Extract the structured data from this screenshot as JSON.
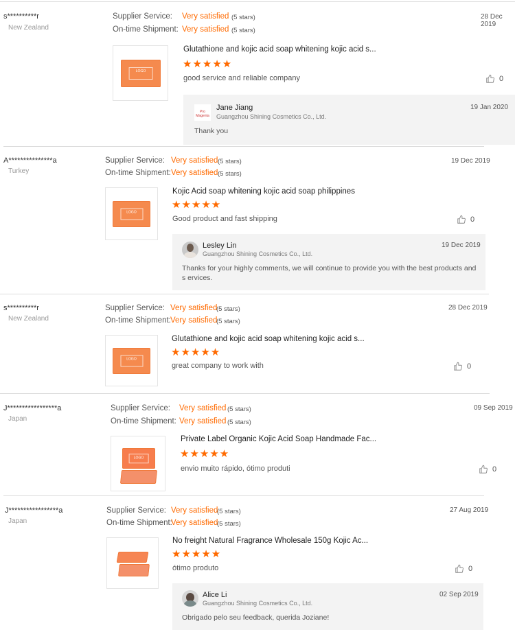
{
  "labels": {
    "supplier_service": "Supplier Service:",
    "ontime_shipment": "On-time Shipment:"
  },
  "reviews": [
    {
      "buyer": "s**********r",
      "country": "New Zealand",
      "service": "Very satisfied",
      "service_stars": "(5 stars)",
      "shipment": "Very satisfied",
      "shipment_stars": "(5 stars)",
      "date": "28 Dec 2019",
      "product": "Glutathione and kojic acid soap whitening kojic acid s...",
      "rating": "★★★★★",
      "comment": "good service and reliable company",
      "likes": "0",
      "reply": {
        "name": "Jane Jiang",
        "company": "Guangzhou Shining Cosmetics Co., Ltd.",
        "date": "19 Jan 2020",
        "text": "Thank you"
      }
    },
    {
      "buyer": "A***************a",
      "country": "Turkey",
      "service": "Very satisfied",
      "service_stars": "(5 stars)",
      "shipment": "Very satisfied",
      "shipment_stars": "(5 stars)",
      "date": "19 Dec 2019",
      "product": "Kojic Acid soap whitening kojic acid soap philippines",
      "rating": "★★★★★",
      "comment": "Good product and fast shipping",
      "likes": "0",
      "reply": {
        "name": "Lesley Lin",
        "company": "Guangzhou Shining Cosmetics Co., Ltd.",
        "date": "19 Dec 2019",
        "text": "Thanks for your highly comments, we will continue to provide you with the best products and s ervices."
      }
    },
    {
      "buyer": "s**********r",
      "country": "New Zealand",
      "service": "Very satisfied",
      "service_stars": "(5 stars)",
      "shipment": "Very satisfied",
      "shipment_stars": "(5 stars)",
      "date": "28 Dec 2019",
      "product": "Glutathione and kojic acid soap whitening kojic acid s...",
      "rating": "★★★★★",
      "comment": "great company to work with",
      "likes": "0"
    },
    {
      "buyer": "J*****************a",
      "country": "Japan",
      "service": "Very satisfied",
      "service_stars": "(5 stars)",
      "shipment": "Very satisfied",
      "shipment_stars": "(5 stars)",
      "date": "09 Sep 2019",
      "product": "Private Label Organic Kojic Acid Soap Handmade Fac...",
      "rating": "★★★★★",
      "comment": "envio muito rápido, ótimo produti",
      "likes": "0"
    },
    {
      "buyer": "J*****************a",
      "country": "Japan",
      "service": "Very satisfied",
      "service_stars": "(5 stars)",
      "shipment": "Very satisfied",
      "shipment_stars": "(5 stars)",
      "date": "27 Aug 2019",
      "product": "No freight Natural Fragrance Wholesale 150g Kojic Ac...",
      "rating": "★★★★★",
      "comment": "ótimo produto",
      "likes": "0",
      "reply": {
        "name": "Alice Li",
        "company": "Guangzhou Shining Cosmetics Co., Ltd.",
        "date": "02 Sep 2019",
        "text": "Obrigado pelo seu feedback, querida Joziane!"
      }
    }
  ],
  "soap_logo_text": "LOGO",
  "brand_logo_text": "Pro Magenta",
  "colors": {
    "accent": "#ff6a00",
    "reply_bg": "#f3f3f3",
    "divider": "#dcdcdc"
  }
}
